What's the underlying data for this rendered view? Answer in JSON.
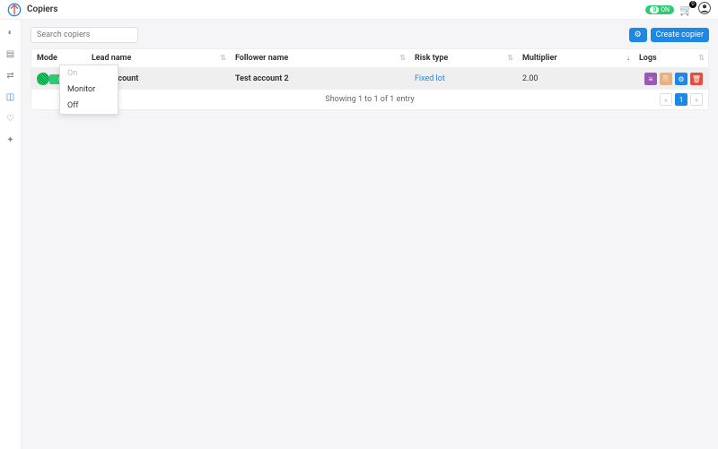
{
  "header": {
    "title": "Copiers",
    "pill_label": "ON",
    "pill_value": "0",
    "cart_count": "0"
  },
  "search": {
    "placeholder": "Search copiers"
  },
  "buttons": {
    "create": "Create copier"
  },
  "columns": {
    "mode": "Mode",
    "lead": "Lead name",
    "follower": "Follower name",
    "risk": "Risk type",
    "multiplier": "Multiplier",
    "logs": "Logs"
  },
  "row": {
    "mode_label": "On",
    "lead": "Test account",
    "follower": "Test account 2",
    "risk": "Fixed lot",
    "multiplier": "2.00"
  },
  "dropdown": {
    "opt1": "On",
    "opt2": "Monitor",
    "opt3": "Off"
  },
  "footer": {
    "text": "Showing 1 to 1 of 1 entry",
    "page": "1"
  }
}
